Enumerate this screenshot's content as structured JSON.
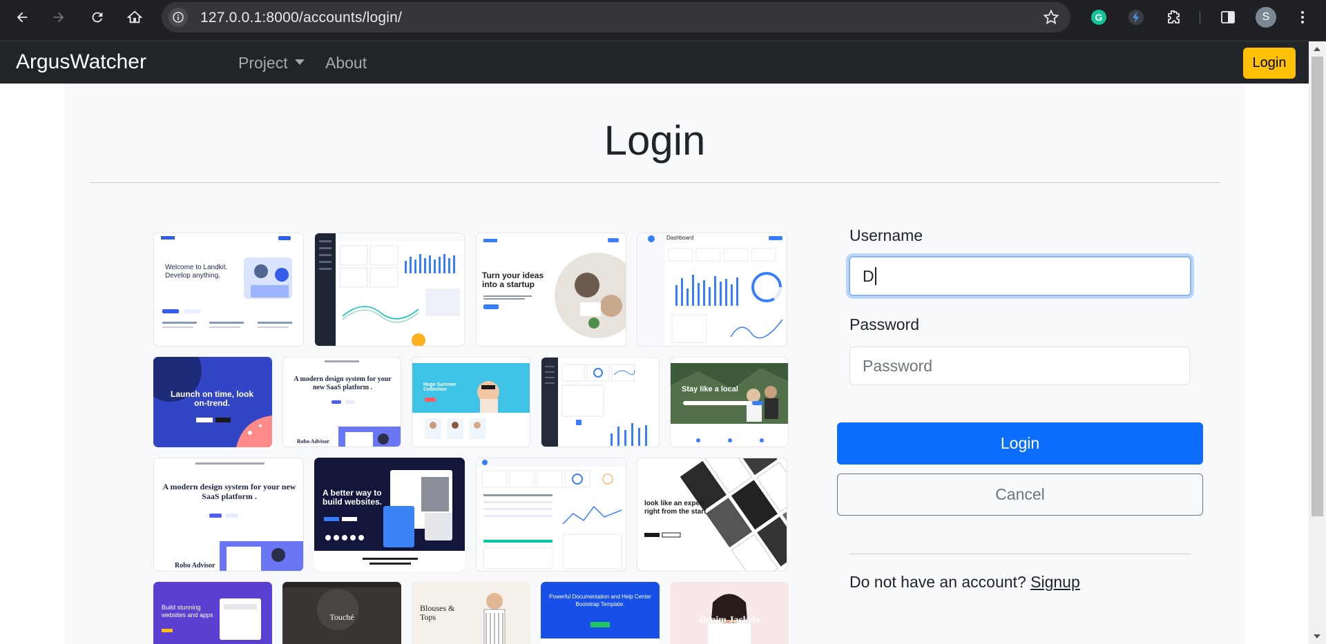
{
  "browser": {
    "url": "127.0.0.1:8000/accounts/login/",
    "profile_initial": "S",
    "colors": {
      "grammarly": "#15c39a",
      "extension": "#4a90e2"
    }
  },
  "navbar": {
    "brand": "ArgusWatcher",
    "items": [
      {
        "label": "Project",
        "has_dropdown": true
      },
      {
        "label": "About",
        "has_dropdown": false
      }
    ],
    "login_label": "Login",
    "login_color": "#ffc107"
  },
  "page": {
    "title": "Login"
  },
  "gallery": {
    "thumbnails": [
      {
        "name": "landkit-welcome",
        "text": "Welcome to Landkit. Develop anything."
      },
      {
        "name": "dashboard-dark-sidebar",
        "text": ""
      },
      {
        "name": "front-startup",
        "text": "Turn your ideas into a startup"
      },
      {
        "name": "dashboard-charts",
        "text": "Dashboard"
      },
      {
        "name": "launch-on-time",
        "text": "Launch on time, look on-trend."
      },
      {
        "name": "saas-design-system",
        "text": "A modern design system for your new SaaS platform ."
      },
      {
        "name": "summer-collection",
        "text": "Huge Summer Collection"
      },
      {
        "name": "admin-dashboard",
        "text": ""
      },
      {
        "name": "stay-like-a-local",
        "text": "Stay like a local"
      },
      {
        "name": "saas-design-system-2",
        "text": "A modern design system for your new SaaS platform ."
      },
      {
        "name": "better-way-websites",
        "text": "A better way to build websites."
      },
      {
        "name": "analytics-dashboard",
        "text": ""
      },
      {
        "name": "look-like-expert",
        "text": "look like an expert right from the start"
      },
      {
        "name": "build-stunning",
        "text": "Build stunning websites and apps"
      },
      {
        "name": "touche",
        "text": "Touché"
      },
      {
        "name": "blouses-tops",
        "text": "Blouses & Tops"
      },
      {
        "name": "documentation-help",
        "text": "Powerful Documentation and Help Center Bootstrap Template."
      },
      {
        "name": "denim-jackets",
        "text": "Denim Jackets"
      }
    ]
  },
  "form": {
    "username_label": "Username",
    "username_value": "D",
    "password_label": "Password",
    "password_placeholder": "Password",
    "login_button": "Login",
    "cancel_button": "Cancel",
    "signup_prompt": "Do not have an account?",
    "signup_link": "Signup",
    "primary_color": "#0d6efd"
  }
}
